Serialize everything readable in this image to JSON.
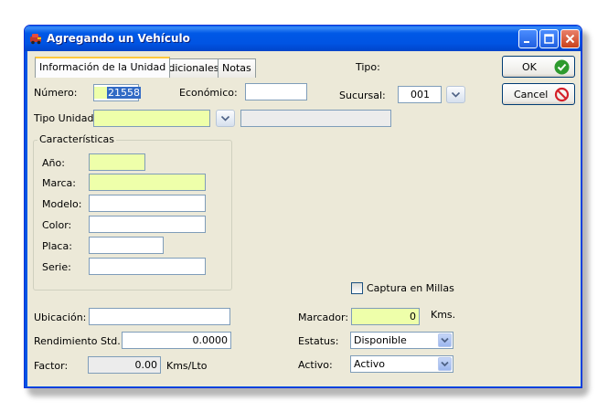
{
  "window": {
    "title": "Agregando un Vehículo"
  },
  "tabs": [
    {
      "label": "Información de la Unidad",
      "active": true
    },
    {
      "label": "Adicionales",
      "active": false
    },
    {
      "label": "Notas",
      "active": false
    }
  ],
  "header": {
    "tipo_label": "Tipo:",
    "sucursal_label": "Sucursal:",
    "sucursal_value": "001"
  },
  "buttons": {
    "ok_label": "OK",
    "cancel_label": "Cancel"
  },
  "form": {
    "numero_label": "Número:",
    "numero_value": "21558",
    "economico_label": "Económico:",
    "economico_value": "",
    "tipo_unidad_label": "Tipo Unidad:",
    "tipo_unidad_value": "",
    "tipo_unidad_desc": ""
  },
  "caracteristicas": {
    "title": "Características",
    "ano_label": "Año:",
    "marca_label": "Marca:",
    "modelo_label": "Modelo:",
    "color_label": "Color:",
    "placa_label": "Placa:",
    "serie_label": "Serie:",
    "ano_value": "",
    "marca_value": "",
    "modelo_value": "",
    "color_value": "",
    "placa_value": "",
    "serie_value": ""
  },
  "bottom": {
    "captura_millas_label": "Captura en Millas",
    "captura_millas_checked": false,
    "ubicacion_label": "Ubicación:",
    "ubicacion_value": "",
    "rendimiento_label": "Rendimiento Std.:",
    "rendimiento_value": "0.0000",
    "factor_label": "Factor:",
    "factor_value": "0.00",
    "factor_unit": "Kms/Lto",
    "marcador_label": "Marcador:",
    "marcador_value": "0",
    "marcador_unit": "Kms.",
    "estatus_label": "Estatus:",
    "estatus_value": "Disponible",
    "activo_label": "Activo:",
    "activo_value": "Activo"
  },
  "colors": {
    "titlebar": "#0054e3",
    "window_bg": "#ece9d8",
    "required_field": "#eeffaa",
    "ok_icon": "#2e9a2e",
    "cancel_icon": "#d4202a"
  },
  "icons": {
    "app": "car-icon",
    "minimize": "minimize-icon",
    "maximize": "maximize-icon",
    "close": "close-icon",
    "ok": "check-circle-icon",
    "cancel": "no-entry-icon",
    "dropdown": "chevron-down-icon"
  }
}
